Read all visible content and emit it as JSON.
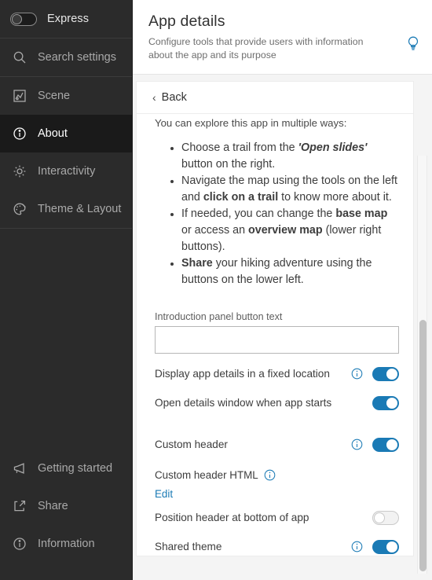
{
  "sidebar": {
    "express": {
      "label": "Express",
      "toggle_state": "off"
    },
    "search": {
      "label": "Search settings",
      "icon": "search-icon"
    },
    "items": [
      {
        "label": "Scene",
        "icon": "scene-icon",
        "active": false
      },
      {
        "label": "About",
        "icon": "info-circle-icon",
        "active": true
      },
      {
        "label": "Interactivity",
        "icon": "gear-icon",
        "active": false
      },
      {
        "label": "Theme & Layout",
        "icon": "palette-icon",
        "active": false
      }
    ],
    "bottom_items": [
      {
        "label": "Getting started",
        "icon": "megaphone-icon"
      },
      {
        "label": "Share",
        "icon": "share-icon"
      },
      {
        "label": "Information",
        "icon": "info-circle-icon"
      }
    ]
  },
  "header": {
    "title": "App details",
    "subtitle": "Configure tools that provide users with information about the app and its purpose",
    "hint_icon": "lightbulb-icon"
  },
  "card": {
    "back_label": "Back",
    "back_chevron": "‹",
    "intro": "You can explore this app in multiple ways:",
    "bullets": [
      {
        "parts": [
          {
            "t": "Choose a trail from the ",
            "s": "n"
          },
          {
            "t": "'Open slides'",
            "s": "i"
          },
          {
            "t": " button on the right.",
            "s": "n"
          }
        ]
      },
      {
        "parts": [
          {
            "t": "Navigate the map using the tools on the left and ",
            "s": "n"
          },
          {
            "t": "click on a trail",
            "s": "b"
          },
          {
            "t": " to know more about it.",
            "s": "n"
          }
        ]
      },
      {
        "parts": [
          {
            "t": "If needed, you can change the ",
            "s": "n"
          },
          {
            "t": "base map",
            "s": "b"
          },
          {
            "t": " or access an ",
            "s": "n"
          },
          {
            "t": "overview map",
            "s": "b"
          },
          {
            "t": " (lower right buttons).",
            "s": "n"
          }
        ]
      },
      {
        "parts": [
          {
            "t": "Share",
            "s": "b"
          },
          {
            "t": " your hiking adventure using the buttons on the lower left.",
            "s": "n"
          }
        ]
      }
    ],
    "intro_button_field": {
      "label": "Introduction panel button text",
      "value": "",
      "placeholder": ""
    },
    "settings": [
      {
        "label": "Display app details in a fixed location",
        "info": true,
        "toggle": "on"
      },
      {
        "label": "Open details window when app starts",
        "info": false,
        "toggle": "on"
      },
      {
        "label": "Custom header",
        "info": true,
        "toggle": "on"
      }
    ],
    "custom_header_html": {
      "label": "Custom header HTML",
      "info": true,
      "edit_label": "Edit"
    },
    "settings_2": [
      {
        "label": "Position header at bottom of app",
        "info": false,
        "toggle": "off"
      },
      {
        "label": "Shared theme",
        "info": true,
        "toggle": "on"
      }
    ]
  },
  "colors": {
    "accent": "#1a7ab5",
    "sidebar_bg": "#2b2b2b",
    "sidebar_active_bg": "#1a1a1a",
    "page_bg": "#f4f4f4"
  }
}
